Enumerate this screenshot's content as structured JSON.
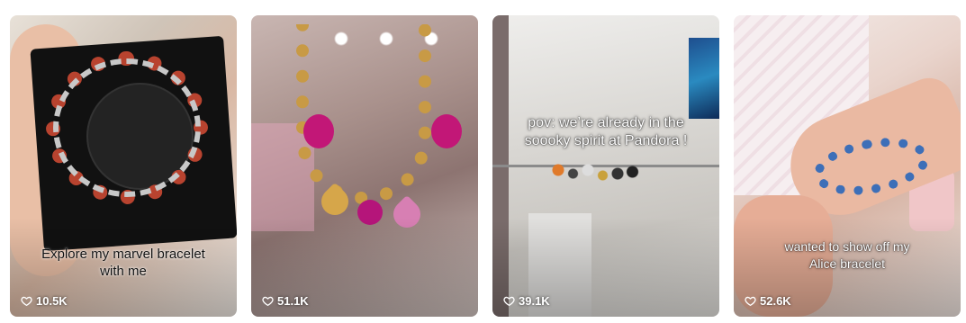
{
  "videos": [
    {
      "caption": "Explore my marvel bracelet\nwith me",
      "likes": "10.5K",
      "like_icon": "heart-outline-icon"
    },
    {
      "caption": "",
      "likes": "51.1K",
      "like_icon": "heart-outline-icon"
    },
    {
      "caption": "pov: we’re already in the\nsoooky spirit at Pandora !",
      "likes": "39.1K",
      "like_icon": "heart-outline-icon"
    },
    {
      "caption": "wanted to show off my\nAlice bracelet",
      "likes": "52.6K",
      "like_icon": "heart-outline-icon"
    }
  ],
  "colors": {
    "like_text": "#ffffff",
    "page_background": "#ffffff"
  }
}
